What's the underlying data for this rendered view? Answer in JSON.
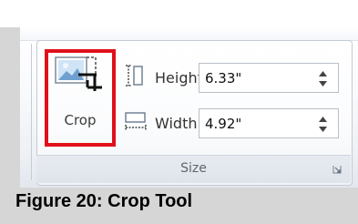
{
  "crop": {
    "label": "Crop",
    "icon": "crop-icon"
  },
  "height": {
    "label": "Height:",
    "value": "6.33\"",
    "icon": "shape-height-icon"
  },
  "width": {
    "label": "Width:",
    "value": "4.92\"",
    "icon": "shape-width-icon"
  },
  "group": {
    "title": "Size",
    "launcher_icon": "dialog-launcher-icon"
  },
  "caption": "Figure 20: Crop Tool",
  "colors": {
    "highlight": "#e0101a",
    "ribbon_border": "#c5cad3"
  }
}
